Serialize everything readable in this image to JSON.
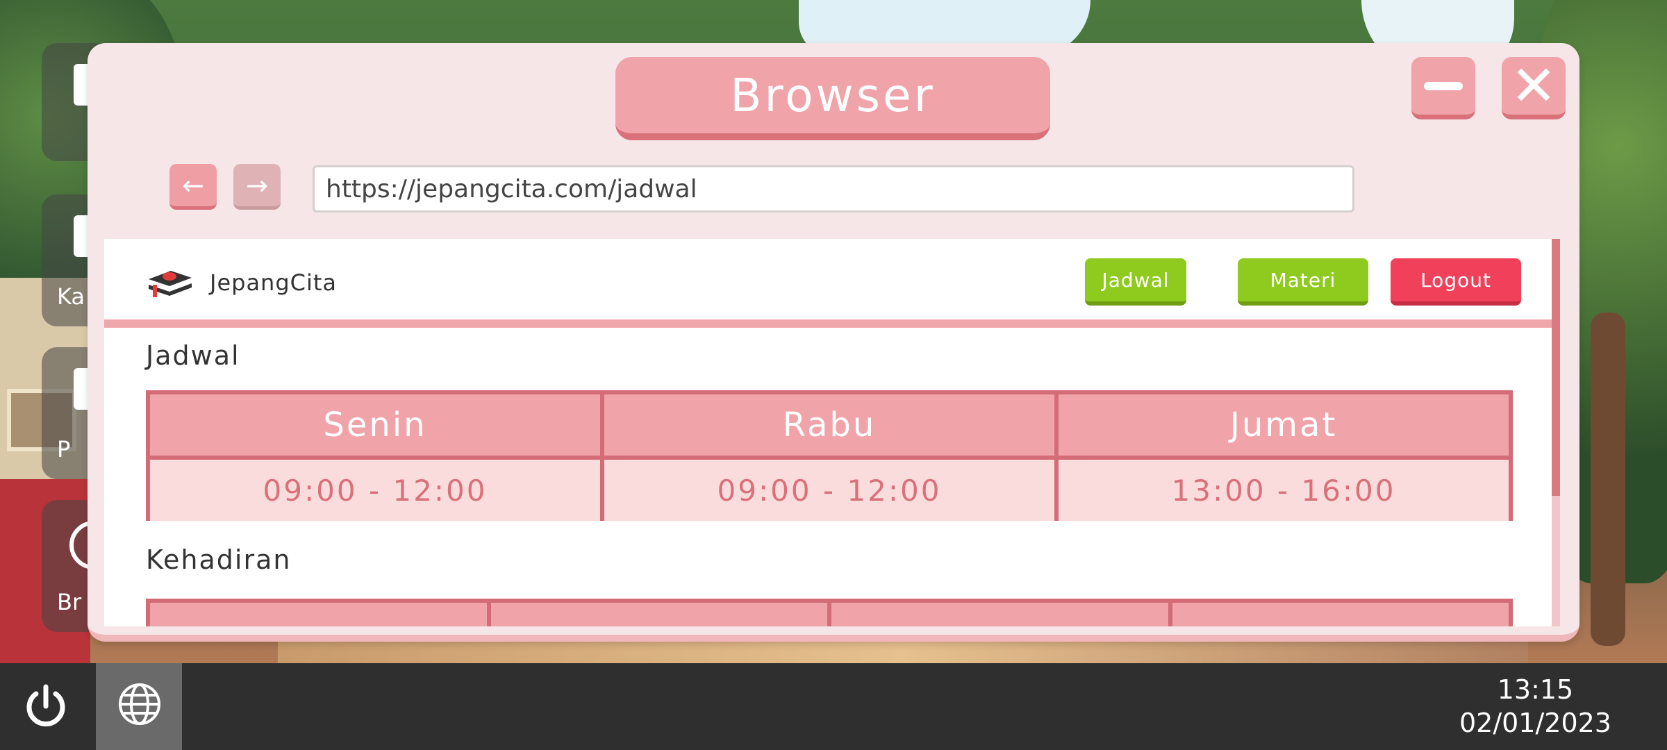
{
  "desktop": {
    "icons": [
      {
        "label": "Ka"
      },
      {
        "label": "P"
      },
      {
        "label": "Br"
      }
    ]
  },
  "window": {
    "title": "Browser",
    "url": "https://jepangcita.com/jadwal"
  },
  "site": {
    "brand": "JepangCita",
    "nav": {
      "jadwal": "Jadwal",
      "materi": "Materi",
      "logout": "Logout"
    },
    "sections": {
      "schedule_title": "Jadwal",
      "attendance_title": "Kehadiran"
    },
    "schedule": [
      {
        "day": "Senin",
        "time": "09:00 - 12:00"
      },
      {
        "day": "Rabu",
        "time": "09:00 - 12:00"
      },
      {
        "day": "Jumat",
        "time": "13:00 - 16:00"
      }
    ]
  },
  "taskbar": {
    "time": "13:15",
    "date": "02/01/2023"
  },
  "icons": {
    "minimize": "minimize-icon",
    "close": "close-icon",
    "back": "arrow-left-icon",
    "forward": "arrow-right-icon",
    "power": "power-icon",
    "browser": "globe-icon"
  },
  "colors": {
    "accent_pink": "#f0a4a9",
    "accent_dark_pink": "#d36c76",
    "green": "#8fca1f",
    "red": "#f0405a"
  }
}
